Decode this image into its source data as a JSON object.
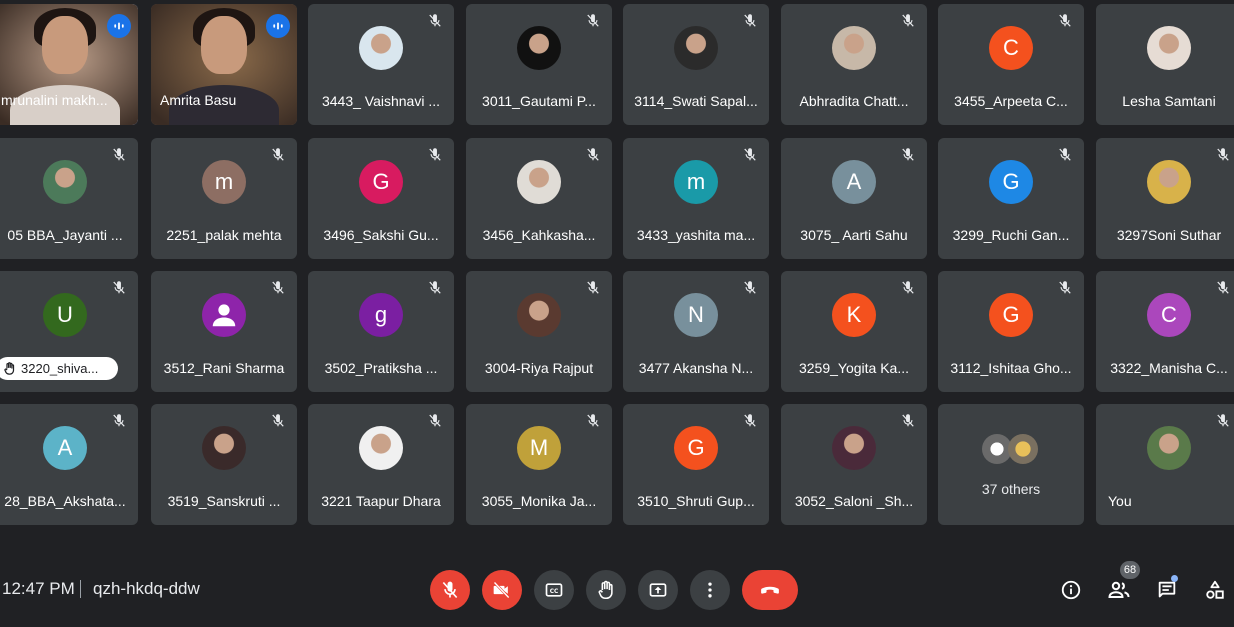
{
  "participants": [
    {
      "name": "mrunalini makh...",
      "kind": "video",
      "speaking": true,
      "active": true,
      "bg": "#b79a86"
    },
    {
      "name": "Amrita Basu",
      "kind": "video",
      "speaking": true,
      "active": false,
      "bg": "#8a6a4a"
    },
    {
      "name": "3443_ Vaishnavi ...",
      "kind": "photo",
      "color": "#d9e6ee"
    },
    {
      "name": "3011_Gautami P...",
      "kind": "photo",
      "color": "#111111"
    },
    {
      "name": "3114_Swati Sapal...",
      "kind": "photo",
      "color": "#2b2b2b"
    },
    {
      "name": "Abhradita Chatt...",
      "kind": "photo",
      "color": "#c7b8a8"
    },
    {
      "name": "3455_Arpeeta C...",
      "kind": "letter",
      "letter": "C",
      "color": "#f4511e"
    },
    {
      "name": "Lesha Samtani",
      "kind": "photo",
      "color": "#e6dcd4",
      "nomic": true
    },
    {
      "name": "05 BBA_Jayanti ...",
      "kind": "photo",
      "color": "#4c7a5a"
    },
    {
      "name": "2251_palak mehta",
      "kind": "letter",
      "letter": "m",
      "color": "#8d6e63"
    },
    {
      "name": "3496_Sakshi Gu...",
      "kind": "letter",
      "letter": "G",
      "color": "#d81b60"
    },
    {
      "name": "3456_Kahkasha...",
      "kind": "photo",
      "color": "#e0dcd6"
    },
    {
      "name": "3433_yashita ma...",
      "kind": "letter",
      "letter": "m",
      "color": "#1a9aa8"
    },
    {
      "name": "3075_ Aarti Sahu",
      "kind": "letter",
      "letter": "A",
      "color": "#78909c"
    },
    {
      "name": "3299_Ruchi Gan...",
      "kind": "letter",
      "letter": "G",
      "color": "#1e88e5"
    },
    {
      "name": "3297Soni Suthar",
      "kind": "photo",
      "color": "#d8b24a"
    },
    {
      "name": "",
      "kind": "letter",
      "letter": "U",
      "color": "#33691e",
      "hand": "3220_shiva..."
    },
    {
      "name": "3512_Rani Sharma",
      "kind": "person",
      "color": "#8e24aa"
    },
    {
      "name": "3502_Pratiksha ...",
      "kind": "letter",
      "letter": "g",
      "color": "#7b1fa2"
    },
    {
      "name": "3004-Riya Rajput",
      "kind": "photo",
      "color": "#5a3a30"
    },
    {
      "name": "3477 Akansha N...",
      "kind": "letter",
      "letter": "N",
      "color": "#78909c"
    },
    {
      "name": "3259_Yogita Ka...",
      "kind": "letter",
      "letter": "K",
      "color": "#f4511e"
    },
    {
      "name": "3112_Ishitaa Gho...",
      "kind": "letter",
      "letter": "G",
      "color": "#f4511e"
    },
    {
      "name": "3322_Manisha C...",
      "kind": "letter",
      "letter": "C",
      "color": "#ab47bc"
    },
    {
      "name": "28_BBA_Akshata...",
      "kind": "letter",
      "letter": "A",
      "color": "#5cb3c8"
    },
    {
      "name": "3519_Sanskruti ...",
      "kind": "photo",
      "color": "#3a2a2a"
    },
    {
      "name": "3221 Taapur Dhara",
      "kind": "photo",
      "color": "#f0f0f0"
    },
    {
      "name": "3055_Monika Ja...",
      "kind": "letter",
      "letter": "M",
      "color": "#c0a13a"
    },
    {
      "name": "3510_Shruti Gup...",
      "kind": "letter",
      "letter": "G",
      "color": "#f4511e"
    },
    {
      "name": "3052_Saloni _Sh...",
      "kind": "photo",
      "color": "#4a2a3a"
    },
    {
      "name": "37 others",
      "kind": "others"
    },
    {
      "name": "You",
      "kind": "photo",
      "color": "#5a7a4a",
      "leftname": true
    }
  ],
  "bottom": {
    "time": "12:47 PM",
    "meeting_code": "qzh-hkdq-ddw",
    "people_count": "68"
  },
  "colors": {
    "background": "#202124",
    "tile": "#3c4043",
    "danger": "#ea4335",
    "accent": "#8ab4f8"
  }
}
